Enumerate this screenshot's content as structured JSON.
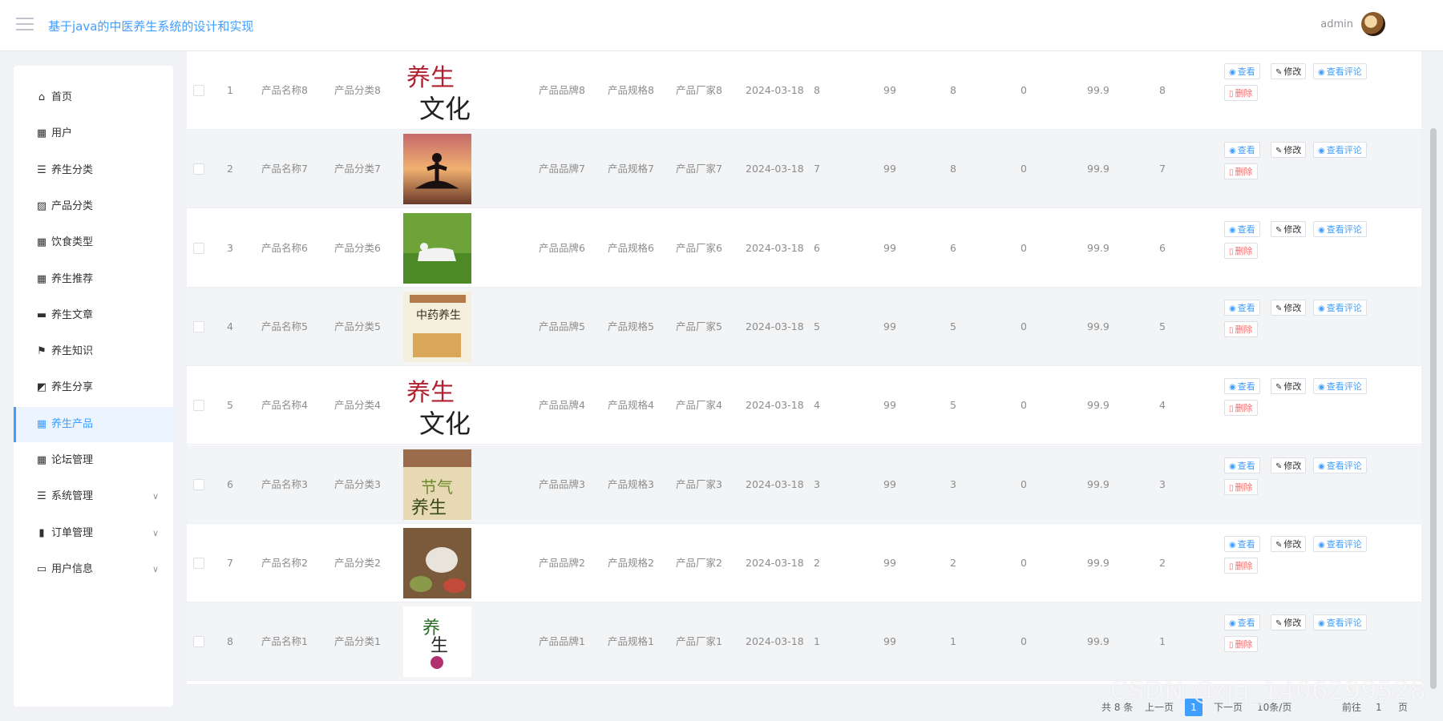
{
  "header": {
    "title": "基于java的中医养生系统的设计和实现",
    "user": "admin"
  },
  "sidebar": {
    "items": [
      {
        "label": "首页",
        "icon": "home-icon",
        "glyph": "⌂",
        "active": false,
        "expandable": false
      },
      {
        "label": "用户",
        "icon": "grid-icon",
        "glyph": "▦",
        "active": false,
        "expandable": false
      },
      {
        "label": "养生分类",
        "icon": "sliders-icon",
        "glyph": "☰",
        "active": false,
        "expandable": false
      },
      {
        "label": "产品分类",
        "icon": "chart-icon",
        "glyph": "▨",
        "active": false,
        "expandable": false
      },
      {
        "label": "饮食类型",
        "icon": "grid-icon",
        "glyph": "▦",
        "active": false,
        "expandable": false
      },
      {
        "label": "养生推荐",
        "icon": "grid-icon",
        "glyph": "▦",
        "active": false,
        "expandable": false
      },
      {
        "label": "养生文章",
        "icon": "printer-icon",
        "glyph": "▬",
        "active": false,
        "expandable": false
      },
      {
        "label": "养生知识",
        "icon": "flag-icon",
        "glyph": "⚑",
        "active": false,
        "expandable": false
      },
      {
        "label": "养生分享",
        "icon": "share-icon",
        "glyph": "◩",
        "active": false,
        "expandable": false
      },
      {
        "label": "养生产品",
        "icon": "grid-icon",
        "glyph": "▦",
        "active": true,
        "expandable": false
      },
      {
        "label": "论坛管理",
        "icon": "grid-icon",
        "glyph": "▦",
        "active": false,
        "expandable": false
      },
      {
        "label": "系统管理",
        "icon": "list-icon",
        "glyph": "☰",
        "active": false,
        "expandable": true
      },
      {
        "label": "订单管理",
        "icon": "box-icon",
        "glyph": "▮",
        "active": false,
        "expandable": true
      },
      {
        "label": "用户信息",
        "icon": "card-icon",
        "glyph": "▭",
        "active": false,
        "expandable": true
      }
    ],
    "chevron": "∨"
  },
  "actions": {
    "view": "查看",
    "edit": "修改",
    "comments": "查看评论",
    "delete": "删除"
  },
  "rows": [
    {
      "index": "1",
      "name": "产品名称8",
      "category": "产品分类8",
      "image": "image-1",
      "brand": "产品品牌8",
      "spec": "产品规格8",
      "maker": "产品厂家8",
      "date": "2024-03-18",
      "c1": "8",
      "c2": "99",
      "c3": "8",
      "c4": "0",
      "price": "99.9",
      "c5": "8"
    },
    {
      "index": "2",
      "name": "产品名称7",
      "category": "产品分类7",
      "image": "image-2",
      "brand": "产品品牌7",
      "spec": "产品规格7",
      "maker": "产品厂家7",
      "date": "2024-03-18",
      "c1": "7",
      "c2": "99",
      "c3": "8",
      "c4": "0",
      "price": "99.9",
      "c5": "7"
    },
    {
      "index": "3",
      "name": "产品名称6",
      "category": "产品分类6",
      "image": "image-3",
      "brand": "产品品牌6",
      "spec": "产品规格6",
      "maker": "产品厂家6",
      "date": "2024-03-18",
      "c1": "6",
      "c2": "99",
      "c3": "6",
      "c4": "0",
      "price": "99.9",
      "c5": "6"
    },
    {
      "index": "4",
      "name": "产品名称5",
      "category": "产品分类5",
      "image": "image-4",
      "brand": "产品品牌5",
      "spec": "产品规格5",
      "maker": "产品厂家5",
      "date": "2024-03-18",
      "c1": "5",
      "c2": "99",
      "c3": "5",
      "c4": "0",
      "price": "99.9",
      "c5": "5"
    },
    {
      "index": "5",
      "name": "产品名称4",
      "category": "产品分类4",
      "image": "image-5",
      "brand": "产品品牌4",
      "spec": "产品规格4",
      "maker": "产品厂家4",
      "date": "2024-03-18",
      "c1": "4",
      "c2": "99",
      "c3": "5",
      "c4": "0",
      "price": "99.9",
      "c5": "4"
    },
    {
      "index": "6",
      "name": "产品名称3",
      "category": "产品分类3",
      "image": "image-6",
      "brand": "产品品牌3",
      "spec": "产品规格3",
      "maker": "产品厂家3",
      "date": "2024-03-18",
      "c1": "3",
      "c2": "99",
      "c3": "3",
      "c4": "0",
      "price": "99.9",
      "c5": "3"
    },
    {
      "index": "7",
      "name": "产品名称2",
      "category": "产品分类2",
      "image": "image-7",
      "brand": "产品品牌2",
      "spec": "产品规格2",
      "maker": "产品厂家2",
      "date": "2024-03-18",
      "c1": "2",
      "c2": "99",
      "c3": "2",
      "c4": "0",
      "price": "99.9",
      "c5": "2"
    },
    {
      "index": "8",
      "name": "产品名称1",
      "category": "产品分类1",
      "image": "image-8",
      "brand": "产品品牌1",
      "spec": "产品规格1",
      "maker": "产品厂家1",
      "date": "2024-03-18",
      "c1": "1",
      "c2": "99",
      "c3": "1",
      "c4": "0",
      "price": "99.9",
      "c5": "1"
    }
  ],
  "pagination": {
    "total": "共 8 条",
    "prev": "上一页",
    "current": "1",
    "next": "下一页",
    "page_size": "10条/页",
    "goto_label": "前往",
    "goto_value": "1",
    "page_suffix": "页"
  },
  "watermark": "CSDN @qq_1406299528",
  "colors": {
    "accent": "#409eff",
    "danger": "#f56c6c",
    "title": "#409eff"
  }
}
